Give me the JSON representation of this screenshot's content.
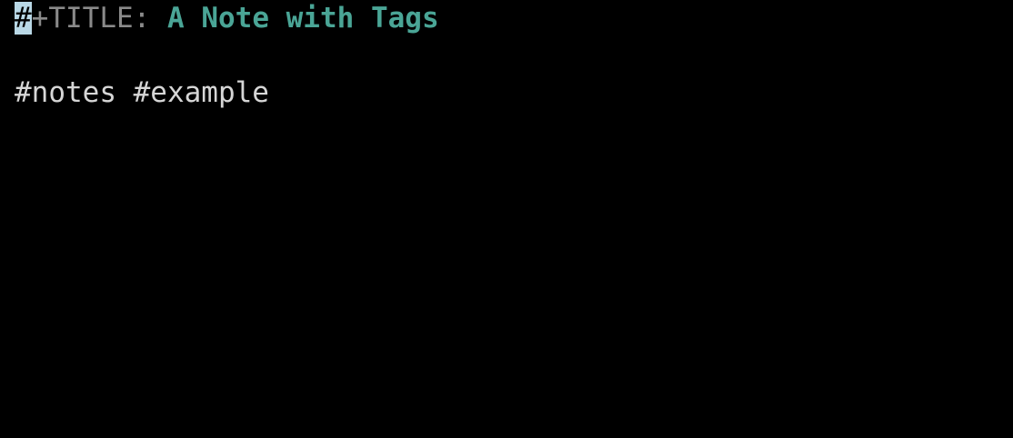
{
  "editor": {
    "line1": {
      "cursor_char": "#",
      "keyword": "+TITLE:",
      "space": " ",
      "title": "A Note with Tags"
    },
    "line2": {
      "tags": "#notes #example"
    }
  },
  "colors": {
    "background": "#000000",
    "keyword": "#8a8a8a",
    "title": "#4aa596",
    "text": "#d6d6d6",
    "cursor": "#b9d8e6"
  }
}
